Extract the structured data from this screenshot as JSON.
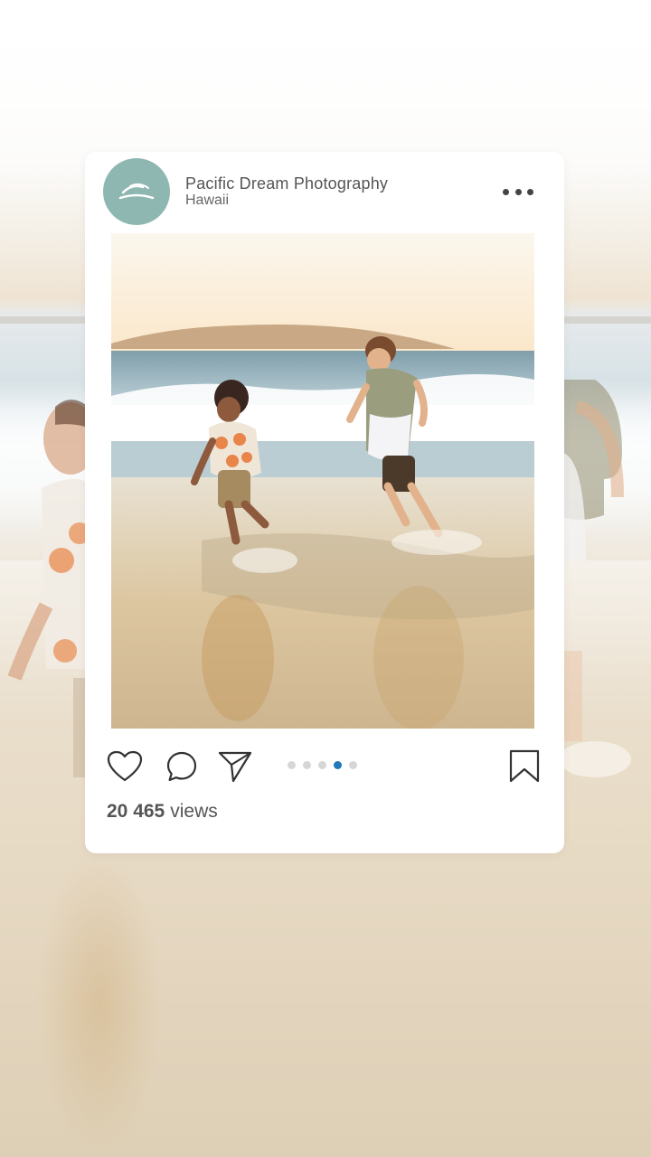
{
  "post": {
    "account_name": "Pacific Dream Photography",
    "location": "Hawaii",
    "avatar_icon": "wave-logo-icon",
    "more_icon": "more-dots-icon",
    "photo_description": "Two boys running through shallow ocean waves at sunset",
    "carousel": {
      "total": 5,
      "active_index": 3
    },
    "views_count": "20 465",
    "views_label": "views"
  },
  "actions": {
    "like_icon": "heart-icon",
    "comment_icon": "comment-icon",
    "share_icon": "share-icon",
    "save_icon": "bookmark-icon"
  },
  "colors": {
    "avatar_bg": "#8fb7b2",
    "active_dot": "#1f78b8",
    "inactive_dot": "#d6d6d6"
  }
}
